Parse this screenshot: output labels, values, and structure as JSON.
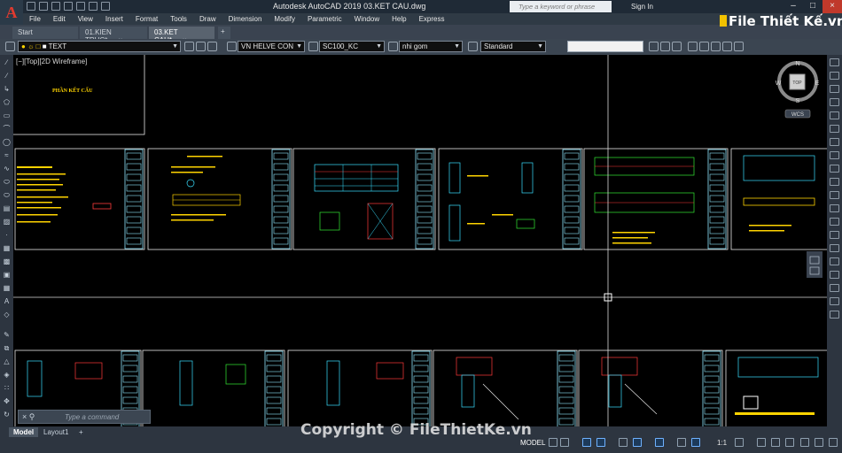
{
  "window": {
    "title": "Autodesk AutoCAD 2019    03.KET CAU.dwg",
    "search_placeholder": "Type a keyword or phrase",
    "signin_label": "Sign In"
  },
  "menu": [
    "File",
    "Edit",
    "View",
    "Insert",
    "Format",
    "Tools",
    "Draw",
    "Dimension",
    "Modify",
    "Parametric",
    "Window",
    "Help",
    "Express"
  ],
  "tabs": [
    {
      "label": "Start",
      "active": false
    },
    {
      "label": "01.KIEN TRUC*",
      "active": false
    },
    {
      "label": "03.KET CAU*",
      "active": true
    }
  ],
  "properties": {
    "layer": "TEXT",
    "text_style": "VN HELVE CON",
    "dim_style": "SC100_KC",
    "multileader_style": "nhi gom",
    "table_style": "Standard"
  },
  "viewport": {
    "label": "[−][Top][2D Wireframe]",
    "sheet_title": "PHẦN KẾT CẤU"
  },
  "viewcube": {
    "top_label": "TOP",
    "north": "N",
    "south": "S",
    "east": "E",
    "west": "W",
    "wcs_label": "WCS"
  },
  "command_line": {
    "placeholder": "Type a command"
  },
  "layout_tabs": [
    {
      "label": "Model",
      "active": true
    },
    {
      "label": "Layout1",
      "active": false
    }
  ],
  "status": {
    "model_label": "MODEL",
    "scale": "1:1"
  },
  "watermarks": {
    "brand": "File Thiết Kế.vn",
    "copyright": "Copyright © FileThietKe.vn"
  },
  "colors": {
    "canvas": "#000000",
    "sheet_border": "#e8e8e8",
    "title_block": "#8fe8ff",
    "drawing_yellow": "#ffd400",
    "drawing_cyan": "#39e0ff",
    "drawing_red": "#ff3b3b",
    "drawing_green": "#35e835",
    "accent_close": "#c0392b"
  }
}
